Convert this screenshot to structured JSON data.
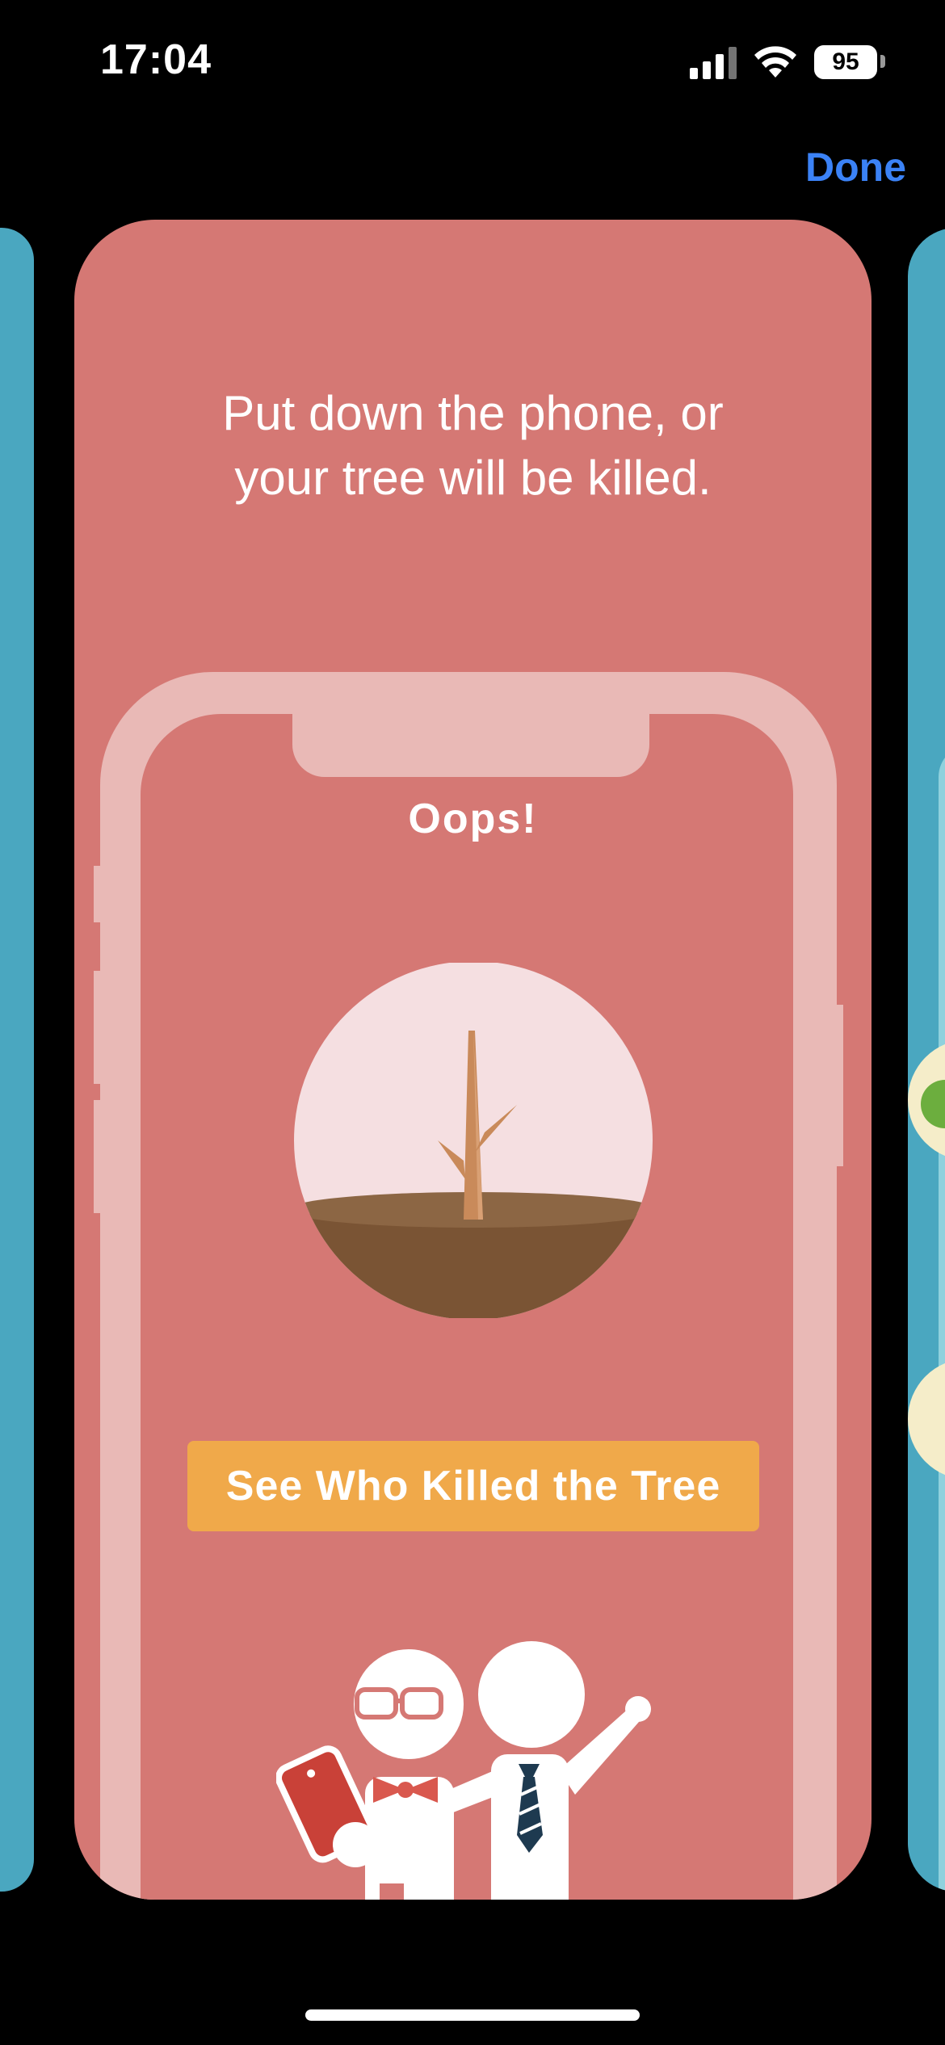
{
  "status_bar": {
    "time": "17:04",
    "battery": "95"
  },
  "nav": {
    "done_label": "Done"
  },
  "card": {
    "headline_line1": "Put down the phone, or",
    "headline_line2": "your tree will be killed.",
    "phone_screen": {
      "title": "Oops!",
      "cta_label": "See Who Killed the Tree"
    }
  },
  "colors": {
    "card_background": "#d57874",
    "phone_frame": "#e9b9b6",
    "cta_background": "#f0a94a",
    "done_link": "#3b82f6",
    "side_card": "#4aa7c0"
  },
  "icons": [
    "signal-icon",
    "wifi-icon",
    "battery-icon",
    "dead-tree-illustration",
    "people-illustration"
  ]
}
